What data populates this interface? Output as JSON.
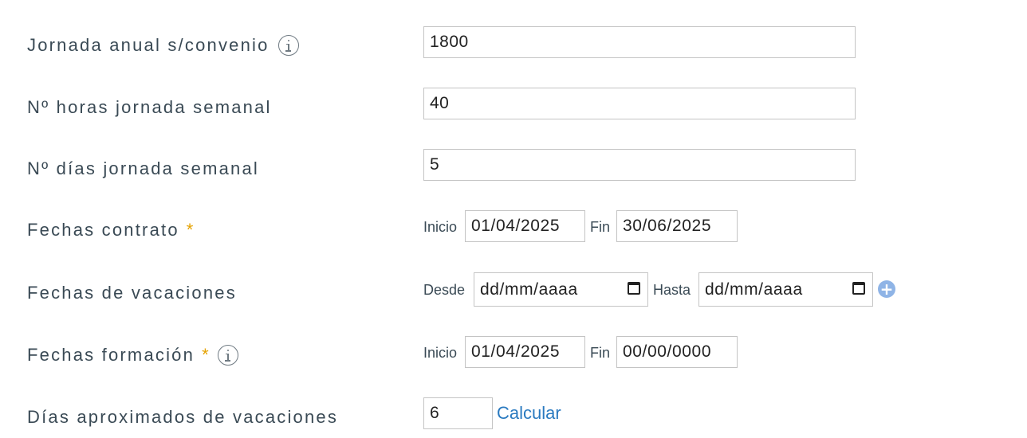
{
  "fields": {
    "jornada_anual": {
      "label": "Jornada anual s/convenio",
      "value": "1800"
    },
    "horas_semanal": {
      "label": "Nº horas jornada semanal",
      "value": "40"
    },
    "dias_semanal": {
      "label": "Nº días jornada semanal",
      "value": "5"
    },
    "fechas_contrato": {
      "label": "Fechas contrato",
      "required_mark": "*",
      "start_label": "Inicio",
      "start_value": "01/04/2025",
      "end_label": "Fin",
      "end_value": "30/06/2025"
    },
    "fechas_vacaciones": {
      "label": "Fechas de vacaciones",
      "from_label": "Desde",
      "from_placeholder": "dd/mm/aaaa",
      "to_label": "Hasta",
      "to_placeholder": "dd/mm/aaaa",
      "add_symbol": "+"
    },
    "fechas_formacion": {
      "label": "Fechas formación",
      "required_mark": "*",
      "start_label": "Inicio",
      "start_value": "01/04/2025",
      "end_label": "Fin",
      "end_value": "00/00/0000"
    },
    "dias_vacaciones": {
      "label": "Días aproximados de vacaciones",
      "value": "6",
      "calc_label": "Calcular"
    }
  },
  "colors": {
    "label_text": "#3a4a55",
    "required": "#e5a200",
    "link": "#2a7ac0",
    "add_button": "#8fb4e6"
  },
  "icons": [
    "info-icon",
    "calendar-icon",
    "add-icon"
  ]
}
